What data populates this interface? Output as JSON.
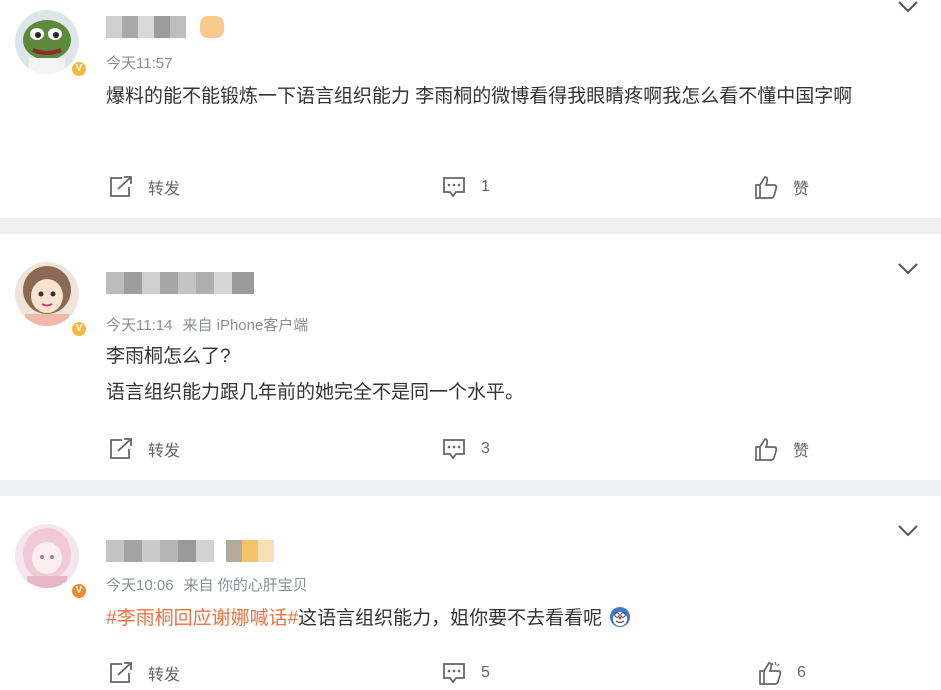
{
  "posts": [
    {
      "time": "今天11:57",
      "source": "",
      "lines": [
        "爆料的能不能锻炼一下语言组织能力 李雨桐的微博看得我眼睛疼啊我怎么看不懂中国字啊"
      ],
      "repost_label": "转发",
      "comment_count": "1",
      "like_label": "赞"
    },
    {
      "time": "今天11:14",
      "source": "来自 iPhone客户端",
      "lines": [
        "李雨桐怎么了?",
        "语言组织能力跟几年前的她完全不是同一个水平。"
      ],
      "repost_label": "转发",
      "comment_count": "3",
      "like_label": "赞"
    },
    {
      "time": "今天10:06",
      "source": "来自 你的心肝宝贝",
      "hashtag": "#李雨桐回应谢娜喊话#",
      "text_after_tag": "这语言组织能力，姐你要不去看看呢",
      "repost_label": "转发",
      "comment_count": "5",
      "like_count": "6"
    }
  ],
  "icons": [
    "chevron-down-icon",
    "repost-icon",
    "comment-icon",
    "like-icon",
    "verified-badge-icon",
    "emoji-icon"
  ],
  "colors": {
    "tag": "#eb7340",
    "meta": "#8a8f97",
    "separator": "#eef0f2",
    "badge": "#f6b83c"
  }
}
